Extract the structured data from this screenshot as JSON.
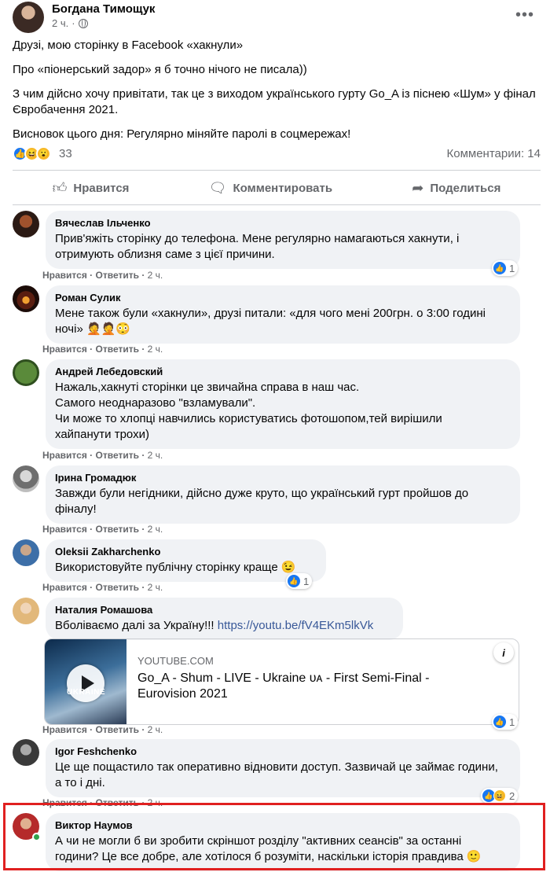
{
  "post": {
    "author": "Богдана Тимощук",
    "time": "2 ч.",
    "more_label": "•••",
    "paragraphs": [
      "Друзі, мою сторінку в Facebook «хакнули»",
      "Про «піонерський задор» я б точно нічого не писала))",
      "З чим дійсно хочу привітати, так це з виходом українського гурту Go_A із піснею «Шум» у фінал Євробачення 2021.",
      "Висновок цього дня: Регулярно міняйте паролі в соцмережах!"
    ],
    "reactions_count": "33",
    "comments_count": "Комментарии: 14"
  },
  "actions": {
    "like": "Нравится",
    "comment": "Комментировать",
    "share": "Поделиться"
  },
  "comment_actions": {
    "like": "Нравится",
    "reply": "Ответить",
    "sep": "·"
  },
  "comments": [
    {
      "name": "Вячеслав Ільченко",
      "text": "Прив'яжіть сторінку до телефона. Мене регулярно намагаються хакнути, і\nотримують облизня саме з цієї причини.",
      "time": "2 ч.",
      "reaction_count": "1"
    },
    {
      "name": "Роман Сулик",
      "text": "Мене також були «хакнули», друзі питали: «для чого мені 200грн. о 3:00 годині\nночі» 🤦🤦😳",
      "time": "2 ч."
    },
    {
      "name": "Андрей Лебедовский",
      "text": "Нажаль,хакнуті сторінки це звичайна справа в наш час.\nСамого неоднаразово \"взламували\".\nЧи може то хлопці навчились користуватись фотошопом,тей вирішили\nхайпанути трохи)",
      "time": "2 ч."
    },
    {
      "name": "Ірина Громадюк",
      "text": "Завжди були негідники, дійсно дуже круто, що український гурт пройшов до\nфіналу!",
      "time": "2 ч."
    },
    {
      "name": "Oleksii Zakharchenko",
      "text": "Використовуйте публічну сторінку краще 😉",
      "time": "2 ч.",
      "reaction_count": "1"
    },
    {
      "name": "Наталия Ромашова",
      "text": "Вболіваємо далі за Україну!!! ",
      "link": "https://youtu.be/fV4EKm5lkVk",
      "time": "2 ч.",
      "reaction_count": "1",
      "preview": {
        "domain": "YOUTUBE.COM",
        "title": "Go_A - Shum - LIVE - Ukraine ᴜᴀ - First Semi-Final - Eurovision 2021",
        "thumb_text": "UKRAINE",
        "info_label": "i"
      }
    },
    {
      "name": "Igor Feshchenko",
      "text": "Це ще пощастило так оперативно відновити доступ. Зазвичай це займає години,\nа то і дні.",
      "time": "2 ч.",
      "reaction_count": "2"
    },
    {
      "name": "Виктор Наумов",
      "text": "А чи не могли б ви зробити скріншот розділу \"активних сеансів\" за останні\nгодини? Це все добре, але хотілося б розуміти, наскільки історія правдива 🙂"
    }
  ],
  "colors": {
    "accent": "#1877f2",
    "highlight": "#e02020",
    "bubble": "#f0f2f5",
    "muted": "#65676b"
  }
}
